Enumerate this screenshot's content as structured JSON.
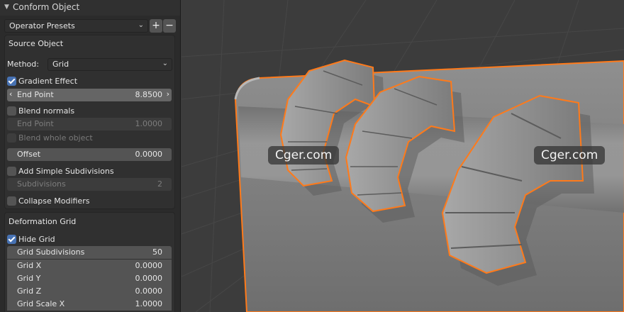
{
  "panel": {
    "header_title": "Conform Object",
    "presets_label": "Operator Presets",
    "add_symbol": "+",
    "remove_symbol": "−",
    "source_object": {
      "title": "Source Object",
      "method_label": "Method:",
      "method_value": "Grid",
      "gradient_effect": {
        "label": "Gradient Effect",
        "checked": true
      },
      "end_point": {
        "label": "End Point",
        "value": "8.8500"
      },
      "blend_normals": {
        "label": "Blend normals",
        "checked": false
      },
      "end_point_disabled": {
        "label": "End Point",
        "value": "1.0000"
      },
      "blend_whole_object": {
        "label": "Blend whole object",
        "checked": false
      },
      "offset": {
        "label": "Offset",
        "value": "0.0000"
      },
      "add_simple_subdivisions": {
        "label": "Add Simple Subdivisions",
        "checked": false
      },
      "subdivisions": {
        "label": "Subdivisions",
        "value": "2"
      },
      "collapse_modifiers": {
        "label": "Collapse Modifiers",
        "checked": false
      }
    },
    "deformation_grid": {
      "title": "Deformation Grid",
      "hide_grid": {
        "label": "Hide Grid",
        "checked": true
      },
      "rows": [
        {
          "label": "Grid Subdivisions",
          "value": "50"
        },
        {
          "label": "Grid X",
          "value": "0.0000"
        },
        {
          "label": "Grid Y",
          "value": "0.0000"
        },
        {
          "label": "Grid Z",
          "value": "0.0000"
        },
        {
          "label": "Grid Scale X",
          "value": "1.0000"
        }
      ]
    }
  },
  "viewport": {
    "watermarks": [
      "Cger.com",
      "Cger.com"
    ],
    "selection_color": "#ff7a1a"
  },
  "colors": {
    "accent": "#4772b3",
    "panel_bg": "#2b2b2b",
    "field_bg": "#545454"
  }
}
